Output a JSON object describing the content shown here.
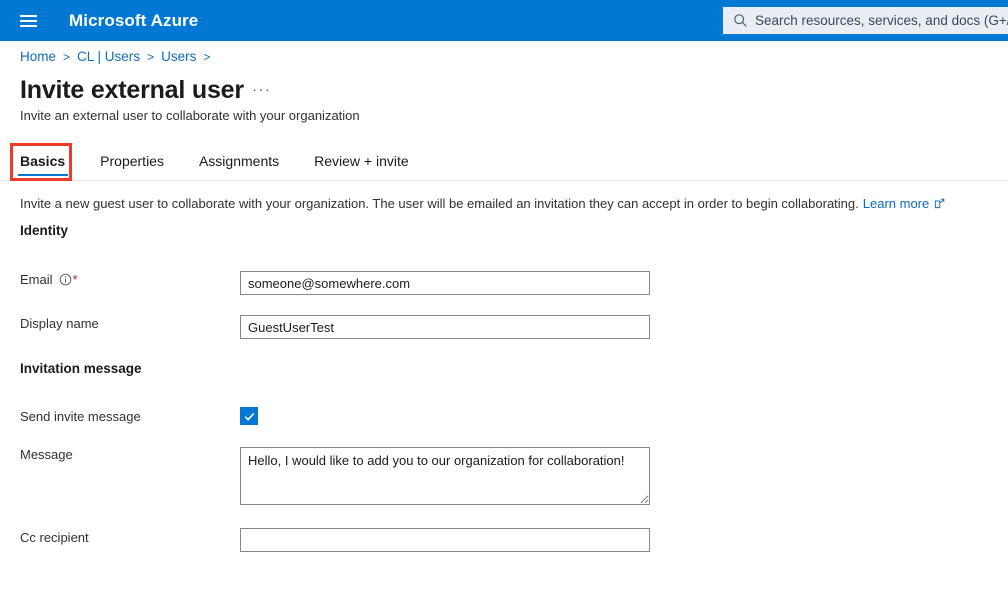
{
  "topbar": {
    "menu_icon": "hamburger-menu-icon",
    "brand": "Microsoft Azure",
    "search": {
      "icon": "search-icon",
      "placeholder": "Search resources, services, and docs (G+/)",
      "value": ""
    }
  },
  "breadcrumb": {
    "items": [
      "Home",
      "CL | Users",
      "Users"
    ],
    "separator": ">"
  },
  "page": {
    "title": "Invite external user",
    "ellipsis": "···",
    "subtitle": "Invite an external user to collaborate with your organization"
  },
  "tabs": [
    {
      "label": "Basics",
      "active": true
    },
    {
      "label": "Properties",
      "active": false
    },
    {
      "label": "Assignments",
      "active": false
    },
    {
      "label": "Review + invite",
      "active": false
    }
  ],
  "description": {
    "text": "Invite a new guest user to collaborate with your organization. The user will be emailed an invitation they can accept in order to begin collaborating.",
    "link_label": "Learn more",
    "link_icon": "external-link-icon"
  },
  "sections": {
    "identity": {
      "heading": "Identity",
      "email": {
        "label": "Email",
        "info_icon": "info-icon",
        "required_marker": "*",
        "value": "someone@somewhere.com",
        "placeholder": ""
      },
      "display_name": {
        "label": "Display name",
        "value": "GuestUserTest",
        "placeholder": ""
      }
    },
    "invitation_message": {
      "heading": "Invitation message",
      "send_invite": {
        "label": "Send invite message",
        "checked": true,
        "check_icon": "checkmark-icon"
      },
      "message": {
        "label": "Message",
        "value": "Hello, I would like to add you to our organization for collaboration!",
        "placeholder": ""
      },
      "cc_recipient": {
        "label": "Cc recipient",
        "value": "",
        "placeholder": ""
      }
    }
  },
  "annotation": {
    "highlight_target": "Basics",
    "color": "#ec3a2b"
  },
  "colors": {
    "azure_blue": "#0078d4",
    "link_blue": "#0f6cbd",
    "required_red": "#a4262c",
    "annotation_red": "#ec3a2b"
  }
}
